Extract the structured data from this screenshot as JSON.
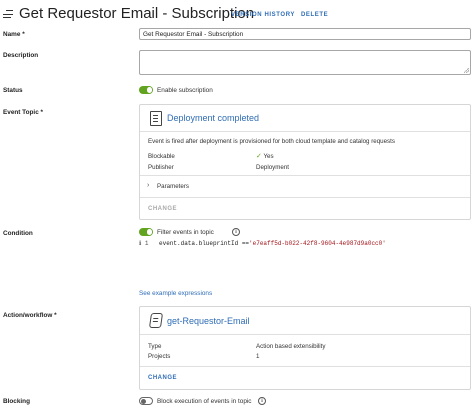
{
  "header": {
    "title": "Get Requestor Email - Subscription",
    "version_history": "VERSION HISTORY",
    "delete": "DELETE"
  },
  "form": {
    "name_label": "Name",
    "name_required": "*",
    "name_value": "Get Requestor Email - Subscription",
    "description_label": "Description",
    "description_value": "",
    "status_label": "Status",
    "status_toggle_label": "Enable subscription",
    "status_enabled": true,
    "event_topic_label": "Event Topic",
    "event_topic_required": "*",
    "condition_label": "Condition",
    "filter_toggle_label": "Filter events in topic",
    "filter_enabled": true,
    "action_label": "Action/workflow",
    "action_required": "*",
    "blocking_label": "Blocking",
    "blocking_toggle_label": "Block execution of events in topic",
    "blocking_enabled": false
  },
  "event_card": {
    "title": "Deployment completed",
    "icon": "document-icon",
    "description": "Event is fired after deployment is provisioned for both cloud template and catalog requests",
    "blockable_key": "Blockable",
    "blockable_check": "✓",
    "blockable_value": "Yes",
    "publisher_key": "Publisher",
    "publisher_value": "Deployment",
    "parameters_label": "Parameters",
    "change_label": "CHANGE"
  },
  "condition_editor": {
    "gutter": "ℹ 1",
    "code_lhs": "event.data.blueprintId",
    "code_op": " ==",
    "code_rhs": "'e7eaff5d-b022-42f8-9604-4e987d9a0cc0'",
    "example_link": "See example expressions"
  },
  "action_card": {
    "title": "get-Requestor-Email",
    "icon": "script-icon",
    "type_key": "Type",
    "type_value": "Action based extensibility",
    "projects_key": "Projects",
    "projects_value": "1",
    "change_label": "CHANGE"
  },
  "colors": {
    "accent": "#2f6db6",
    "toggle_on": "#62a420",
    "string": "#a3151b"
  }
}
